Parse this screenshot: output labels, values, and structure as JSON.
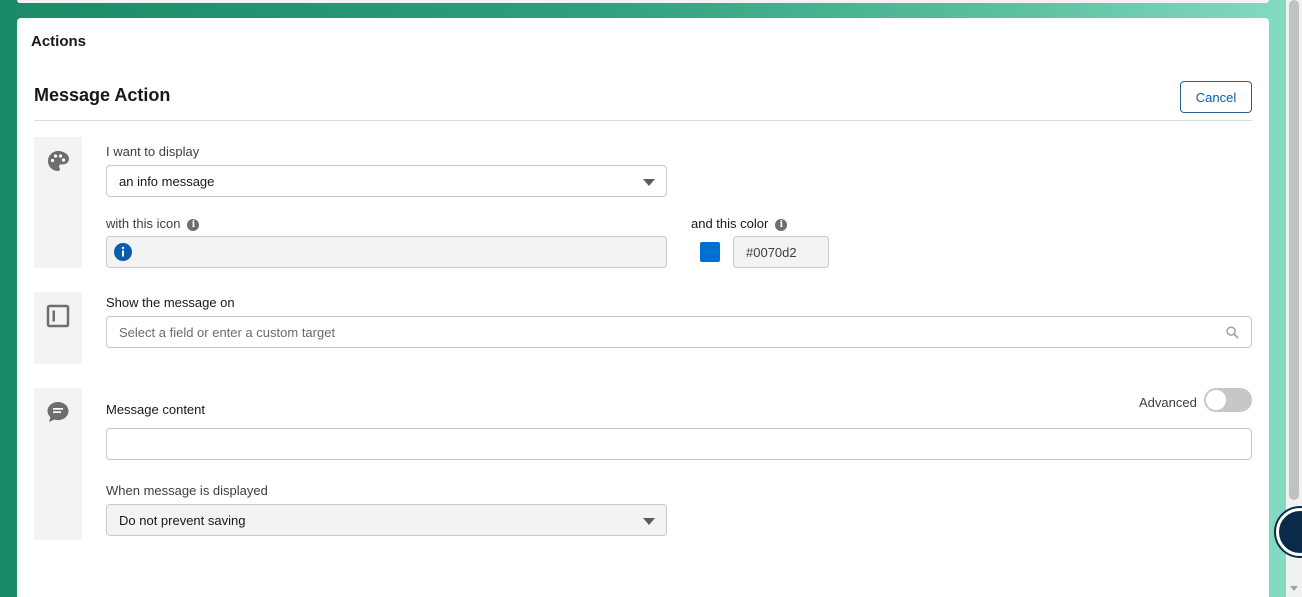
{
  "panel": {
    "title": "Actions",
    "section_title": "Message Action",
    "cancel_label": "Cancel"
  },
  "display": {
    "label": "I want to display",
    "value": "an info message",
    "icon_label": "with this icon",
    "color_label": "and this color",
    "color_value": "#0070d2"
  },
  "target": {
    "label": "Show the message on",
    "placeholder": "Select a field or enter a custom target"
  },
  "content": {
    "label": "Message content",
    "value": "",
    "advanced_label": "Advanced",
    "advanced_on": false,
    "when_label": "When message is displayed",
    "when_value": "Do not prevent saving"
  },
  "colors": {
    "accent": "#0070d2",
    "button_text": "#0b5cab"
  },
  "icons": [
    "palette-icon",
    "info-icon",
    "layout-icon",
    "search-icon",
    "chat-icon",
    "chevron-down-icon"
  ]
}
